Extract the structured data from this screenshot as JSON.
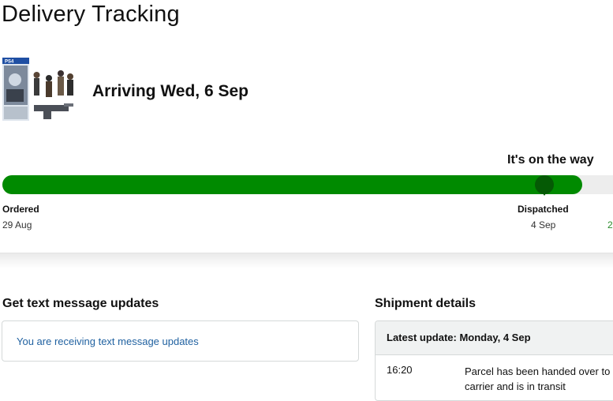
{
  "page": {
    "title": "Delivery Tracking"
  },
  "product": {
    "image_alt": "Destiny 2 PS4 game box",
    "box_title": "PS4",
    "arrival": "Arriving Wed, 6 Sep"
  },
  "tracker": {
    "status": "It's on the way",
    "progress": 0.93,
    "steps": [
      {
        "label": "Ordered",
        "date": "29 Aug"
      },
      {
        "label": "Dispatched",
        "date": "4 Sep"
      },
      {
        "label": "",
        "date": "2"
      }
    ]
  },
  "sms": {
    "heading": "Get text message updates",
    "message": "You are receiving text message updates"
  },
  "shipment": {
    "heading": "Shipment details",
    "latest_update": "Latest update: Monday, 4 Sep",
    "events": [
      {
        "time": "16:20",
        "description": "Parcel has been handed over to carrier and is in transit"
      }
    ]
  },
  "colors": {
    "progress": "#008a00",
    "marker": "#055a05",
    "link": "#2162a1"
  }
}
